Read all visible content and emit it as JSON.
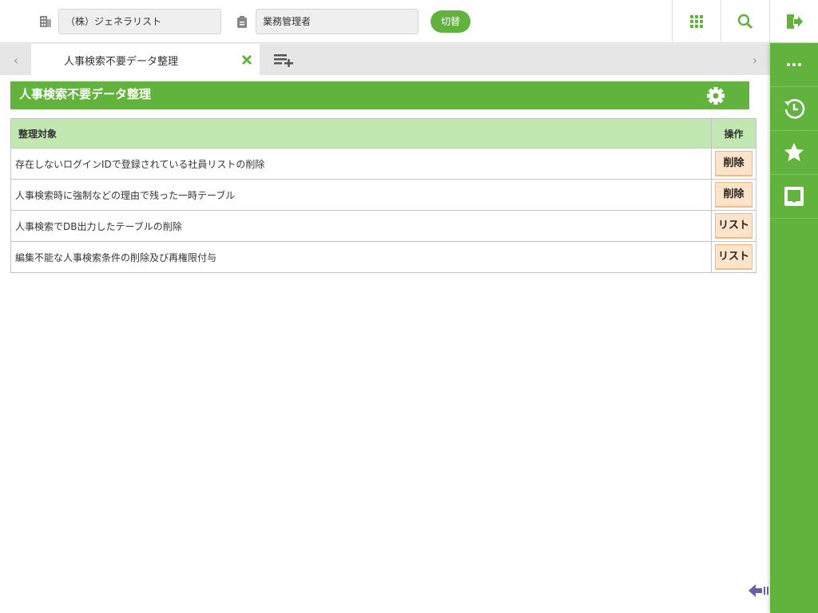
{
  "header": {
    "company": "（株）ジェネラリスト",
    "role": "業務管理者",
    "switch_label": "切替"
  },
  "tabs": [
    {
      "label": "人事検索不要データ整理"
    }
  ],
  "page": {
    "title": "人事検索不要データ整理"
  },
  "table": {
    "headers": [
      "整理対象",
      "操作"
    ],
    "rows": [
      {
        "target": "存在しないログインIDで登録されている社員リストの削除",
        "action": "削除"
      },
      {
        "target": "人事検索時に強制などの理由で残った一時テーブル",
        "action": "削除"
      },
      {
        "target": "人事検索でDB出力したテーブルの削除",
        "action": "リスト"
      },
      {
        "target": "編集不能な人事検索条件の削除及び再権限付与",
        "action": "リスト"
      }
    ]
  },
  "colors": {
    "accent": "#62b33d",
    "header_row": "#c2e8b1",
    "action_button": "#fde3c8"
  }
}
